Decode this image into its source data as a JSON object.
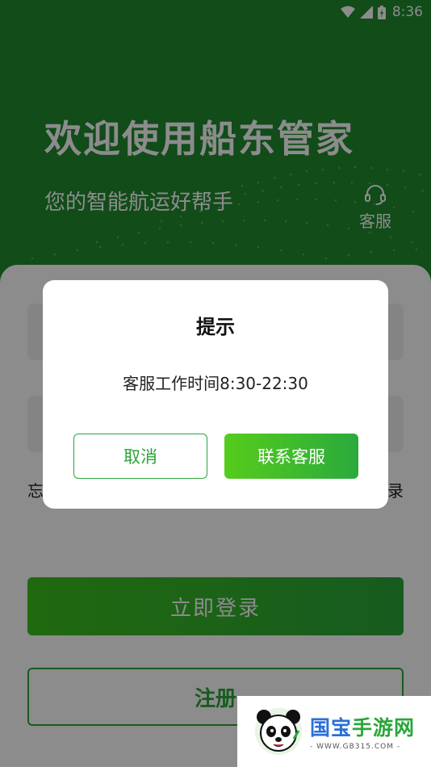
{
  "status_bar": {
    "time": "8:36"
  },
  "hero": {
    "title": "欢迎使用船东管家",
    "subtitle": "您的智能航运好帮手",
    "customer_service_label": "客服"
  },
  "login_form": {
    "forgot_password_label": "忘",
    "code_login_label": "录",
    "login_button": "立即登录",
    "register_button": "注册"
  },
  "dialog": {
    "title": "提示",
    "message": "客服工作时间8:30-22:30",
    "cancel_label": "取消",
    "confirm_label": "联系客服"
  },
  "watermark": {
    "text_part1": "国宝",
    "text_part2": "手游网",
    "url": "- WWW.GB315.COM -"
  },
  "colors": {
    "brand_green": "#2aa63a",
    "hero_green": "#1f8a2e",
    "overlay": "rgba(0,0,0,0.45)"
  },
  "icons": [
    "wifi-icon",
    "signal-icon",
    "battery-icon",
    "headset-icon",
    "panda-logo-icon"
  ]
}
